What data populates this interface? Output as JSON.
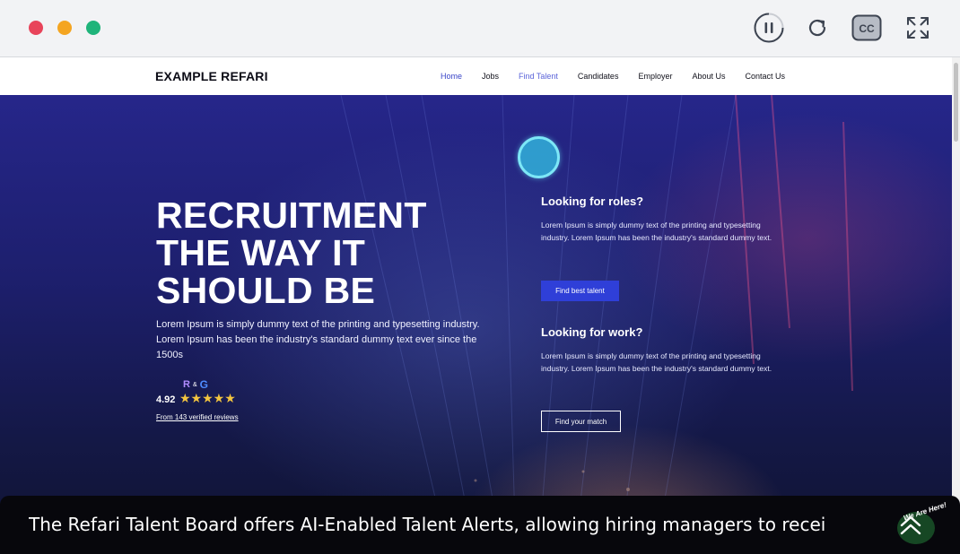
{
  "player": {
    "controls": [
      "pause-icon",
      "reload-icon",
      "cc-icon",
      "expand-icon"
    ],
    "cc_label": "CC"
  },
  "site": {
    "logo": "EXAMPLE REFARI",
    "nav": [
      "Home",
      "Jobs",
      "Find Talent",
      "Candidates",
      "Employer",
      "About Us",
      "Contact Us"
    ],
    "active_nav": "Home"
  },
  "hero": {
    "title_lines": [
      "RECRUITMENT",
      "THE WAY IT",
      "SHOULD BE"
    ],
    "subtitle": "Lorem Ipsum is simply dummy text of the printing and typesetting industry. Lorem Ipsum has been the industry's standard dummy text ever since the 1500s",
    "rating": {
      "score": "4.92",
      "stars": "★★★★★",
      "badge_r": "R",
      "badge_amp": "&",
      "badge_g": "G",
      "reviews": "From 143 verified reviews"
    }
  },
  "roles": {
    "heading": "Looking for roles?",
    "text": "Lorem Ipsum is simply dummy text of the printing and typesetting industry. Lorem Ipsum has been the industry's standard dummy text.",
    "button": "Find best talent"
  },
  "work": {
    "heading": "Looking for work?",
    "text": "Lorem Ipsum is simply dummy text of the printing and typesetting industry. Lorem Ipsum has been the industry's standard dummy text.",
    "button": "Find your match"
  },
  "caption": {
    "text": "The Refari Talent Board offers AI-Enabled Talent Alerts, allowing hiring managers to recei",
    "chat_label": "We Are Here!"
  },
  "colors": {
    "accent": "#2f3fd8",
    "cursor": "#31b2da",
    "caption_bg": "#07070c"
  }
}
